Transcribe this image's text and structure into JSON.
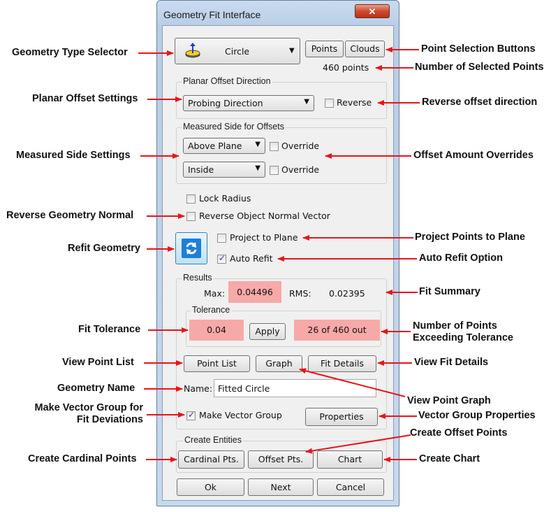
{
  "window": {
    "title": "Geometry Fit Interface",
    "close_glyph": "✕"
  },
  "geometry": {
    "type": "Circle"
  },
  "points": {
    "points_btn": "Points",
    "clouds_btn": "Clouds",
    "count": "460 points"
  },
  "planar": {
    "title": "Planar Offset Direction",
    "direction": "Probing Direction",
    "reverse": "Reverse"
  },
  "measured": {
    "title": "Measured Side for Offsets",
    "side1": "Above Plane",
    "side2": "Inside",
    "override": "Override"
  },
  "options": {
    "lock_radius": "Lock Radius",
    "reverse_normal": "Reverse Object Normal Vector",
    "project": "Project to Plane",
    "auto_refit": "Auto Refit",
    "auto_refit_checked": true
  },
  "results": {
    "title": "Results",
    "max_label": "Max:",
    "max": "0.04496",
    "rms_label": "RMS:",
    "rms": "0.02395",
    "tolerance_title": "Tolerance",
    "tolerance": "0.04",
    "apply": "Apply",
    "out": "26 of 460 out",
    "point_list": "Point List",
    "graph": "Graph",
    "fit_details": "Fit Details",
    "name_label": "Name:",
    "name": "Fitted Circle",
    "vector_group": "Make Vector Group",
    "vector_group_checked": true,
    "properties": "Properties"
  },
  "entities": {
    "title": "Create Entities",
    "cardinal": "Cardinal Pts.",
    "offset": "Offset Pts.",
    "chart": "Chart"
  },
  "footer": {
    "ok": "Ok",
    "next": "Next",
    "cancel": "Cancel"
  },
  "annotations": {
    "geometry_type_selector": "Geometry Type Selector",
    "planar_offset_settings": "Planar Offset Settings",
    "measured_side_settings": "Measured Side Settings",
    "reverse_geometry_normal": "Reverse Geometry Normal",
    "refit_geometry": "Refit Geometry",
    "fit_tolerance": "Fit Tolerance",
    "view_point_list": "View Point List",
    "geometry_name": "Geometry Name",
    "make_vector_group_1": "Make Vector Group for",
    "make_vector_group_2": "Fit Deviations",
    "create_cardinal_points": "Create Cardinal Points",
    "point_selection_buttons": "Point Selection Buttons",
    "number_selected_points": "Number of Selected Points",
    "reverse_offset_direction": "Reverse offset direction",
    "offset_amount_overrides": "Offset Amount Overrides",
    "project_points_to_plane": "Project Points to Plane",
    "auto_refit_option": "Auto Refit Option",
    "fit_summary": "Fit Summary",
    "num_points_exceeding_1": "Number of Points",
    "num_points_exceeding_2": "Exceeding Tolerance",
    "view_fit_details": "View Fit Details",
    "view_point_graph": "View Point Graph",
    "vector_group_properties": "Vector Group Properties",
    "create_offset_points": "Create Offset Points",
    "create_chart": "Create Chart"
  },
  "colors": {
    "annotation_arrow": "#e8141c",
    "highlight": "#f7a9a8",
    "refit_button": "#1e7fd6"
  }
}
